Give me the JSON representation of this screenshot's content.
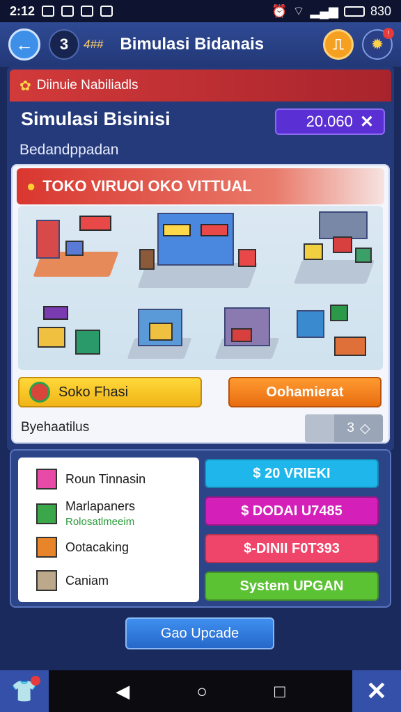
{
  "status_bar": {
    "time": "2:12",
    "battery": "830"
  },
  "header": {
    "back_icon": "arrow-left-icon",
    "level": "3",
    "level_sub": "4##",
    "title": "Bimulasi Bidanais"
  },
  "banner": {
    "label": "Diinuie Nabiliadls"
  },
  "simulation": {
    "title": "Simulasi Bisinisi",
    "subtitle": "Bedandppadan",
    "money": "20.060",
    "money_close": "✕"
  },
  "store": {
    "banner_title": "TOKO VIRUOI  OKO VITTUAL",
    "yellow_button": "Soko Fhasi",
    "orange_button": "Oohamierat",
    "stat_label": "Byehaatilus",
    "stepper_value": "3"
  },
  "list": {
    "items": [
      {
        "label": "Roun Tinnasin",
        "sub": ""
      },
      {
        "label": "Marlapaners",
        "sub": "Rolosatlmeeim"
      },
      {
        "label": "Ootacaking",
        "sub": ""
      },
      {
        "label": "Caniam",
        "sub": ""
      }
    ]
  },
  "actions": [
    {
      "label": "$ 20 VRIEKI",
      "color": "#1fb6ec"
    },
    {
      "label": "$ DODAI U7485",
      "color": "#d41fb8"
    },
    {
      "label": "$-DINII F0T393",
      "color": "#f0456a"
    },
    {
      "label": "System UPGAN",
      "color": "#5bc234"
    }
  ],
  "main_button": "Gao Upcade",
  "colors": {
    "header": "#2f4a94",
    "panel": "#243a7a",
    "accent_red": "#d2363a"
  }
}
